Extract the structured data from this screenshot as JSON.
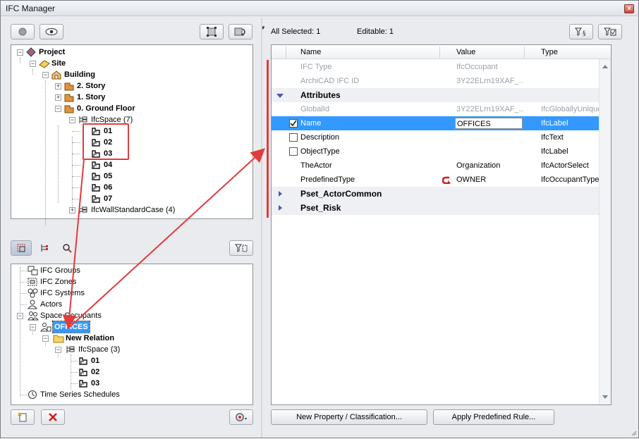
{
  "window": {
    "title": "IFC Manager",
    "close_label": "×"
  },
  "top_tree": {
    "rows": [
      {
        "label": "Project",
        "bold": true
      },
      {
        "label": "Site",
        "bold": true
      },
      {
        "label": "Building",
        "bold": true
      },
      {
        "label": "2. Story",
        "bold": true
      },
      {
        "label": "1. Story",
        "bold": true
      },
      {
        "label": "0. Ground Floor",
        "bold": true
      },
      {
        "label": "IfcSpace (7)",
        "bold": false
      },
      {
        "label": "01",
        "bold": true
      },
      {
        "label": "02",
        "bold": true
      },
      {
        "label": "03",
        "bold": true
      },
      {
        "label": "04",
        "bold": true
      },
      {
        "label": "05",
        "bold": true
      },
      {
        "label": "06",
        "bold": true
      },
      {
        "label": "07",
        "bold": true
      },
      {
        "label": "IfcWallStandardCase (4)",
        "bold": false
      }
    ]
  },
  "bottom_tree": {
    "rows": [
      {
        "label": "IFC Groups"
      },
      {
        "label": "IFC Zones"
      },
      {
        "label": "IFC Systems"
      },
      {
        "label": "Actors"
      },
      {
        "label": "Space Occupants"
      },
      {
        "label": "OFFICES"
      },
      {
        "label": "New Relation"
      },
      {
        "label": "IfcSpace (3)"
      },
      {
        "label": "01"
      },
      {
        "label": "02"
      },
      {
        "label": "03"
      },
      {
        "label": "Time Series Schedules"
      }
    ]
  },
  "status": {
    "all_selected": "All Selected: 1",
    "editable": "Editable: 1"
  },
  "grid": {
    "columns": [
      "Name",
      "Value",
      "Type"
    ],
    "rows": [
      {
        "kind": "item",
        "name": "IFC Type",
        "value": "IfcOccupant",
        "type": "",
        "disabled": true
      },
      {
        "kind": "item",
        "name": "ArchiCAD IFC ID",
        "value": "3Y22ELrn19XAF_...",
        "type": "",
        "disabled": true
      },
      {
        "kind": "group",
        "name": "Attributes",
        "expanded": true
      },
      {
        "kind": "item",
        "name": "GlobalId",
        "value": "3Y22ELrn19XAF_...",
        "type": "IfcGloballyUniqueId",
        "disabled": true
      },
      {
        "kind": "item",
        "name": "Name",
        "value": "OFFICES",
        "type": "IfcLabel",
        "checkbox": true,
        "checked": true,
        "selected": true
      },
      {
        "kind": "item",
        "name": "Description",
        "value": "",
        "type": "IfcText",
        "checkbox": true,
        "checked": false
      },
      {
        "kind": "item",
        "name": "ObjectType",
        "value": "",
        "type": "IfcLabel",
        "checkbox": true,
        "checked": false
      },
      {
        "kind": "item",
        "name": "TheActor",
        "value": "Organization",
        "type": "IfcActorSelect"
      },
      {
        "kind": "item",
        "name": "PredefinedType",
        "value": "OWNER",
        "type": "IfcOccupantTypeEnum"
      },
      {
        "kind": "group",
        "name": "Pset_ActorCommon",
        "expanded": false
      },
      {
        "kind": "group",
        "name": "Pset_Risk",
        "expanded": false
      }
    ]
  },
  "buttons": {
    "new_property": "New Property / Classification...",
    "apply_rule": "Apply Predefined Rule..."
  },
  "colors": {
    "selection": "#3399ff",
    "annotation": "#e23b3b"
  }
}
